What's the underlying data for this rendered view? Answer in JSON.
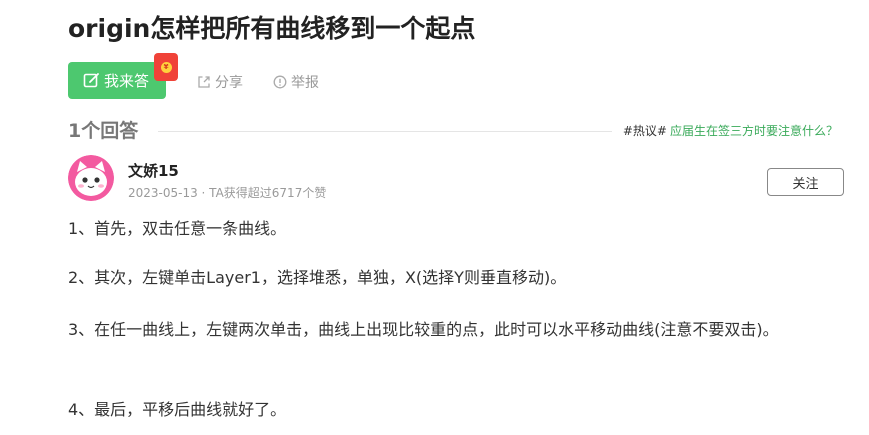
{
  "question": {
    "title": "origin怎样把所有曲线移到一个起点"
  },
  "actions": {
    "answer_label": "我来答",
    "redpacket_glyph": "¥",
    "share_label": "分享",
    "report_label": "举报"
  },
  "answers_header": {
    "count_label": "1个回答",
    "hot_tag": "#热议#",
    "hot_link": "应届生在签三方时要注意什么？"
  },
  "answer": {
    "author_name": "文娇15",
    "meta": "2023-05-13 · TA获得超过6717个赞",
    "follow_label": "关注",
    "paragraphs": [
      "1、首先，双击任意一条曲线。",
      "2、其次，左键单击Layer1，选择堆悉，单独，X(选择Y则垂直移动)。",
      "3、在任一曲线上，左键两次单击，曲线上出现比较重的点，此时可以水平移动曲线(注意不要双击)。",
      "4、最后，平移后曲线就好了。"
    ]
  },
  "colors": {
    "accent_green": "#4dc86f",
    "link_green": "#3aaa5a",
    "redpacket": "#f04238",
    "avatar_bg": "#f35aa0"
  }
}
